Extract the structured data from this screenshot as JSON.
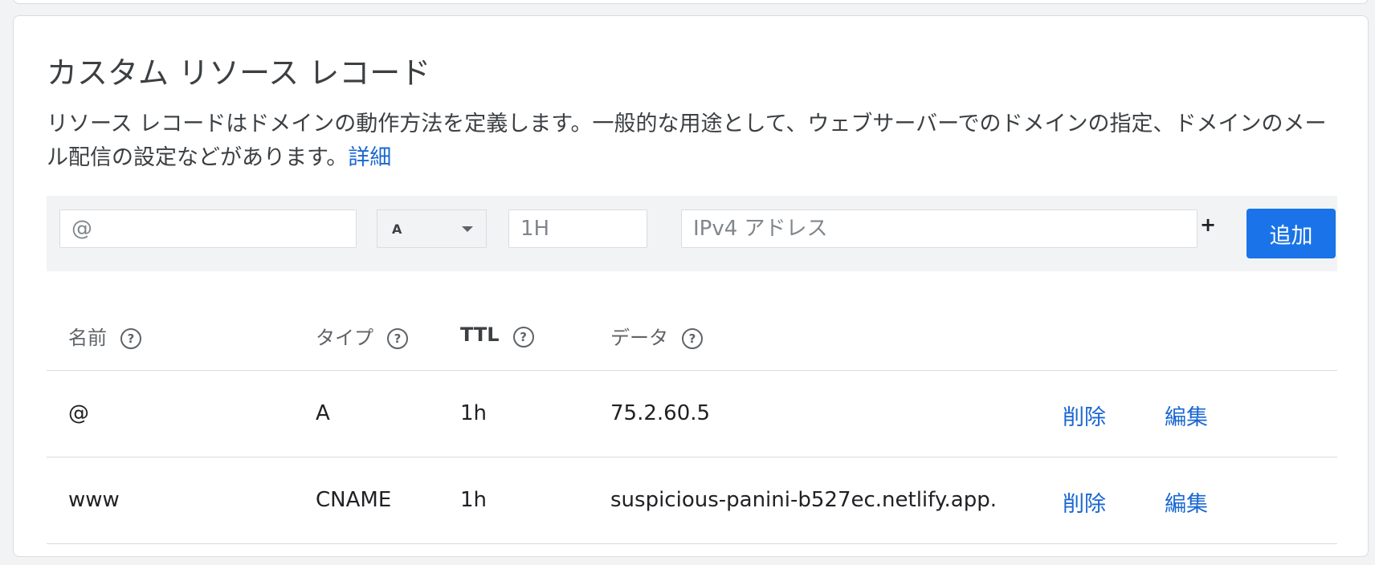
{
  "section": {
    "title": "カスタム リソース レコード",
    "description": "リソース レコードはドメインの動作方法を定義します。一般的な用途として、ウェブサーバーでのドメインの指定、ドメインのメール配信の設定などがあります。",
    "learn_more": "詳細"
  },
  "add_form": {
    "name_placeholder": "@",
    "type_value": "A",
    "ttl_placeholder": "1H",
    "data_placeholder": "IPv4 アドレス",
    "plus_label": "+",
    "add_button": "追加"
  },
  "table": {
    "headers": {
      "name": "名前",
      "type": "タイプ",
      "ttl": "TTL",
      "data": "データ"
    },
    "help_glyph": "?",
    "rows": [
      {
        "name": "@",
        "type": "A",
        "ttl": "1h",
        "data": "75.2.60.5",
        "delete": "削除",
        "edit": "編集"
      },
      {
        "name": "www",
        "type": "CNAME",
        "ttl": "1h",
        "data": "suspicious-panini-b527ec.netlify.app.",
        "delete": "削除",
        "edit": "編集"
      }
    ]
  },
  "colors": {
    "primary": "#1a73e8",
    "link": "#1967d2",
    "form_background": "#f1f3f4",
    "divider": "#dadce0"
  }
}
